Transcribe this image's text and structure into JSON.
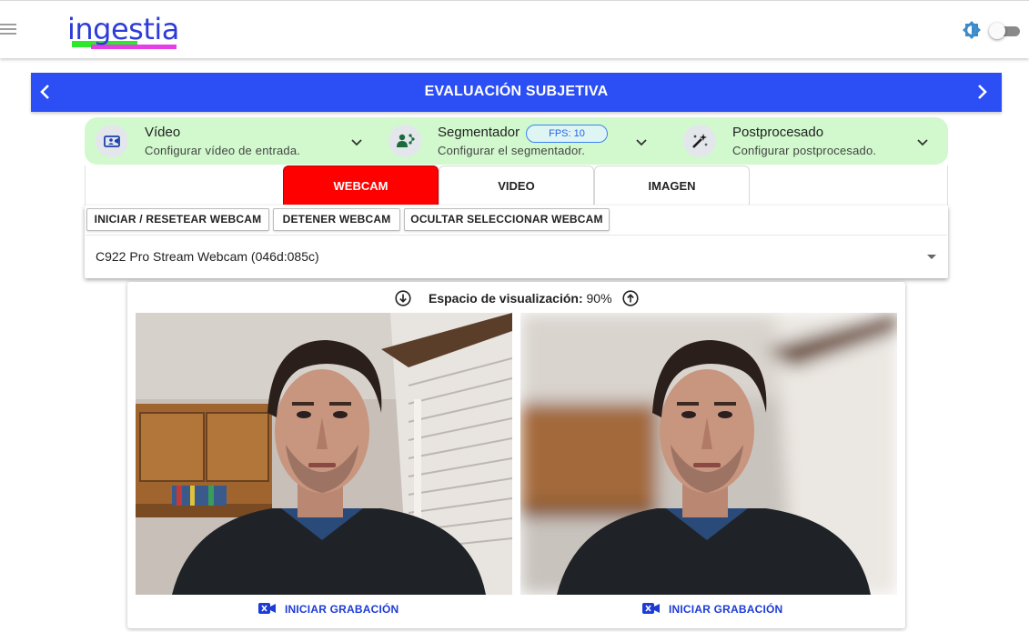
{
  "header": {
    "logo_text": "ingestia",
    "menu_icon": "hamburger-icon",
    "theme_icon": "brightness-icon",
    "accent": "#2c4ef5"
  },
  "title_bar": {
    "title": "EVALUACIÓN SUBJETIVA",
    "prev_icon": "chevron-left-icon",
    "next_icon": "chevron-right-icon",
    "color": "#2c4ef5"
  },
  "config": {
    "background": "#d1f9cd",
    "sections": [
      {
        "icon": "video-camera-icon",
        "title": "Vídeo",
        "subtitle": "Configurar vídeo de entrada."
      },
      {
        "icon": "segmenter-icon",
        "title": "Segmentador",
        "subtitle": "Configurar el segmentador.",
        "badge": "FPS: 10"
      },
      {
        "icon": "magic-wand-icon",
        "title": "Postprocesado",
        "subtitle": "Configurar postprocesado."
      }
    ]
  },
  "tabs": [
    {
      "label": "WEBCAM",
      "active": true
    },
    {
      "label": "VIDEO",
      "active": false
    },
    {
      "label": "IMAGEN",
      "active": false
    }
  ],
  "actions": {
    "start_reset": "INICIAR / RESETEAR WEBCAM",
    "stop": "DETENER WEBCAM",
    "hide_select": "OCULTAR SELECCIONAR WEBCAM"
  },
  "webcam_select": {
    "value": "C922 Pro Stream Webcam (046d:085c)"
  },
  "visualization": {
    "label": "Espacio de visualización:",
    "value": "90%",
    "decrease_icon": "arrow-down-circle-icon",
    "increase_icon": "arrow-up-circle-icon"
  },
  "outputs": [
    {
      "name": "original-webcam-frame",
      "record_label": "INICIAR GRABACIÓN"
    },
    {
      "name": "processed-blur-frame",
      "record_label": "INICIAR GRABACIÓN"
    }
  ]
}
